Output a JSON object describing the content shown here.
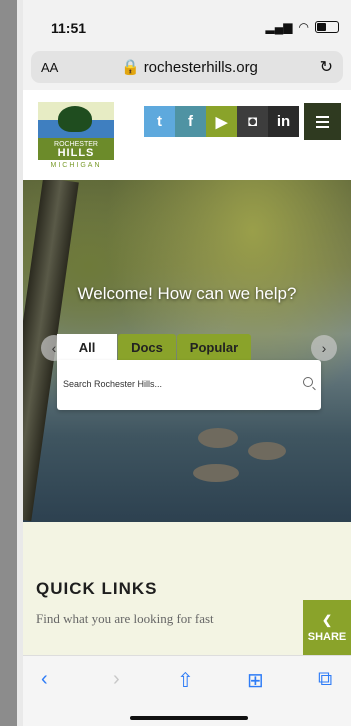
{
  "status": {
    "time": "11:51"
  },
  "browser": {
    "aa": "AA",
    "url": "rochesterhills.org",
    "reload": "↻"
  },
  "logo": {
    "line1": "ROCHESTER",
    "line2": "HILLS",
    "line3": "MICHIGAN"
  },
  "social": {
    "twitter": "t",
    "facebook": "f",
    "youtube": "▶",
    "instagram": "◘",
    "linkedin": "in"
  },
  "hero": {
    "welcome": "Welcome! How can we help?",
    "tabs": [
      "All",
      "Docs",
      "Popular"
    ],
    "search_placeholder": "Search Rochester Hills..."
  },
  "quick_links": {
    "title": "QUICK LINKS",
    "subtitle": "Find what you are looking for fast"
  },
  "share": {
    "label": "SHARE"
  },
  "colors": {
    "accent": "#8aa32a",
    "dark": "#2f3a20",
    "ios_blue": "#2e7cf6"
  }
}
